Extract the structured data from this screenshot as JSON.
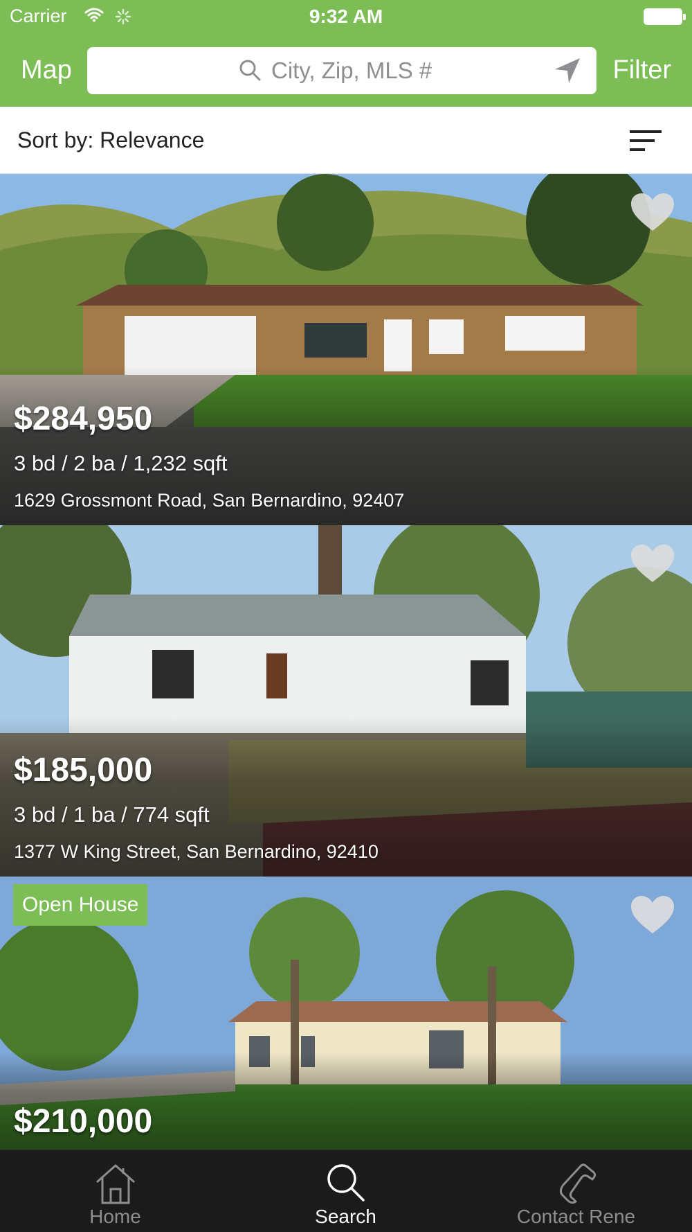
{
  "status_bar": {
    "carrier": "Carrier",
    "time": "9:32 AM"
  },
  "nav": {
    "map_label": "Map",
    "filter_label": "Filter",
    "search_placeholder": "City, Zip, MLS #"
  },
  "sort": {
    "label": "Sort by: Relevance"
  },
  "listings": [
    {
      "price": "$284,950",
      "specs": "3 bd / 2 ba / 1,232 sqft",
      "address": "1629 Grossmont Road, San Bernardino, 92407",
      "badge": ""
    },
    {
      "price": "$185,000",
      "specs": "3 bd / 1 ba / 774 sqft",
      "address": "1377 W King Street, San Bernardino, 92410",
      "badge": ""
    },
    {
      "price": "$210,000",
      "specs": "",
      "address": "",
      "badge": "Open House"
    }
  ],
  "tabs": [
    {
      "label": "Home",
      "icon": "house-icon",
      "active": false
    },
    {
      "label": "Search",
      "icon": "search-icon",
      "active": true
    },
    {
      "label": "Contact Rene",
      "icon": "phone-icon",
      "active": false
    }
  ],
  "colors": {
    "brand_green": "#7cbd55",
    "tab_bar": "#1b1b1b",
    "tab_inactive": "#8e8e8e",
    "tab_active": "#ffffff"
  }
}
